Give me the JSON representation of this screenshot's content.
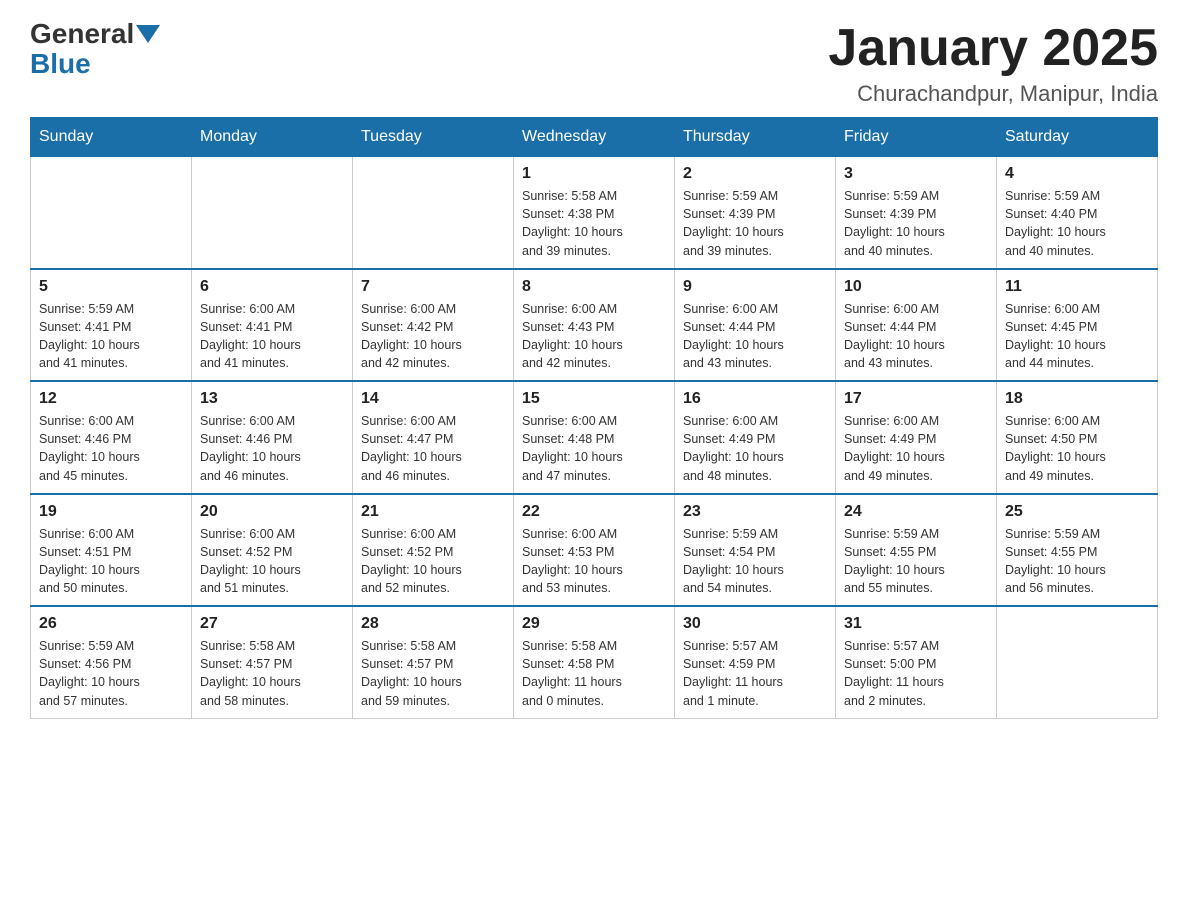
{
  "header": {
    "logo_general": "General",
    "logo_blue": "Blue",
    "month_title": "January 2025",
    "location": "Churachandpur, Manipur, India"
  },
  "weekdays": [
    "Sunday",
    "Monday",
    "Tuesday",
    "Wednesday",
    "Thursday",
    "Friday",
    "Saturday"
  ],
  "weeks": [
    [
      {
        "day": "",
        "info": ""
      },
      {
        "day": "",
        "info": ""
      },
      {
        "day": "",
        "info": ""
      },
      {
        "day": "1",
        "info": "Sunrise: 5:58 AM\nSunset: 4:38 PM\nDaylight: 10 hours\nand 39 minutes."
      },
      {
        "day": "2",
        "info": "Sunrise: 5:59 AM\nSunset: 4:39 PM\nDaylight: 10 hours\nand 39 minutes."
      },
      {
        "day": "3",
        "info": "Sunrise: 5:59 AM\nSunset: 4:39 PM\nDaylight: 10 hours\nand 40 minutes."
      },
      {
        "day": "4",
        "info": "Sunrise: 5:59 AM\nSunset: 4:40 PM\nDaylight: 10 hours\nand 40 minutes."
      }
    ],
    [
      {
        "day": "5",
        "info": "Sunrise: 5:59 AM\nSunset: 4:41 PM\nDaylight: 10 hours\nand 41 minutes."
      },
      {
        "day": "6",
        "info": "Sunrise: 6:00 AM\nSunset: 4:41 PM\nDaylight: 10 hours\nand 41 minutes."
      },
      {
        "day": "7",
        "info": "Sunrise: 6:00 AM\nSunset: 4:42 PM\nDaylight: 10 hours\nand 42 minutes."
      },
      {
        "day": "8",
        "info": "Sunrise: 6:00 AM\nSunset: 4:43 PM\nDaylight: 10 hours\nand 42 minutes."
      },
      {
        "day": "9",
        "info": "Sunrise: 6:00 AM\nSunset: 4:44 PM\nDaylight: 10 hours\nand 43 minutes."
      },
      {
        "day": "10",
        "info": "Sunrise: 6:00 AM\nSunset: 4:44 PM\nDaylight: 10 hours\nand 43 minutes."
      },
      {
        "day": "11",
        "info": "Sunrise: 6:00 AM\nSunset: 4:45 PM\nDaylight: 10 hours\nand 44 minutes."
      }
    ],
    [
      {
        "day": "12",
        "info": "Sunrise: 6:00 AM\nSunset: 4:46 PM\nDaylight: 10 hours\nand 45 minutes."
      },
      {
        "day": "13",
        "info": "Sunrise: 6:00 AM\nSunset: 4:46 PM\nDaylight: 10 hours\nand 46 minutes."
      },
      {
        "day": "14",
        "info": "Sunrise: 6:00 AM\nSunset: 4:47 PM\nDaylight: 10 hours\nand 46 minutes."
      },
      {
        "day": "15",
        "info": "Sunrise: 6:00 AM\nSunset: 4:48 PM\nDaylight: 10 hours\nand 47 minutes."
      },
      {
        "day": "16",
        "info": "Sunrise: 6:00 AM\nSunset: 4:49 PM\nDaylight: 10 hours\nand 48 minutes."
      },
      {
        "day": "17",
        "info": "Sunrise: 6:00 AM\nSunset: 4:49 PM\nDaylight: 10 hours\nand 49 minutes."
      },
      {
        "day": "18",
        "info": "Sunrise: 6:00 AM\nSunset: 4:50 PM\nDaylight: 10 hours\nand 49 minutes."
      }
    ],
    [
      {
        "day": "19",
        "info": "Sunrise: 6:00 AM\nSunset: 4:51 PM\nDaylight: 10 hours\nand 50 minutes."
      },
      {
        "day": "20",
        "info": "Sunrise: 6:00 AM\nSunset: 4:52 PM\nDaylight: 10 hours\nand 51 minutes."
      },
      {
        "day": "21",
        "info": "Sunrise: 6:00 AM\nSunset: 4:52 PM\nDaylight: 10 hours\nand 52 minutes."
      },
      {
        "day": "22",
        "info": "Sunrise: 6:00 AM\nSunset: 4:53 PM\nDaylight: 10 hours\nand 53 minutes."
      },
      {
        "day": "23",
        "info": "Sunrise: 5:59 AM\nSunset: 4:54 PM\nDaylight: 10 hours\nand 54 minutes."
      },
      {
        "day": "24",
        "info": "Sunrise: 5:59 AM\nSunset: 4:55 PM\nDaylight: 10 hours\nand 55 minutes."
      },
      {
        "day": "25",
        "info": "Sunrise: 5:59 AM\nSunset: 4:55 PM\nDaylight: 10 hours\nand 56 minutes."
      }
    ],
    [
      {
        "day": "26",
        "info": "Sunrise: 5:59 AM\nSunset: 4:56 PM\nDaylight: 10 hours\nand 57 minutes."
      },
      {
        "day": "27",
        "info": "Sunrise: 5:58 AM\nSunset: 4:57 PM\nDaylight: 10 hours\nand 58 minutes."
      },
      {
        "day": "28",
        "info": "Sunrise: 5:58 AM\nSunset: 4:57 PM\nDaylight: 10 hours\nand 59 minutes."
      },
      {
        "day": "29",
        "info": "Sunrise: 5:58 AM\nSunset: 4:58 PM\nDaylight: 11 hours\nand 0 minutes."
      },
      {
        "day": "30",
        "info": "Sunrise: 5:57 AM\nSunset: 4:59 PM\nDaylight: 11 hours\nand 1 minute."
      },
      {
        "day": "31",
        "info": "Sunrise: 5:57 AM\nSunset: 5:00 PM\nDaylight: 11 hours\nand 2 minutes."
      },
      {
        "day": "",
        "info": ""
      }
    ]
  ]
}
